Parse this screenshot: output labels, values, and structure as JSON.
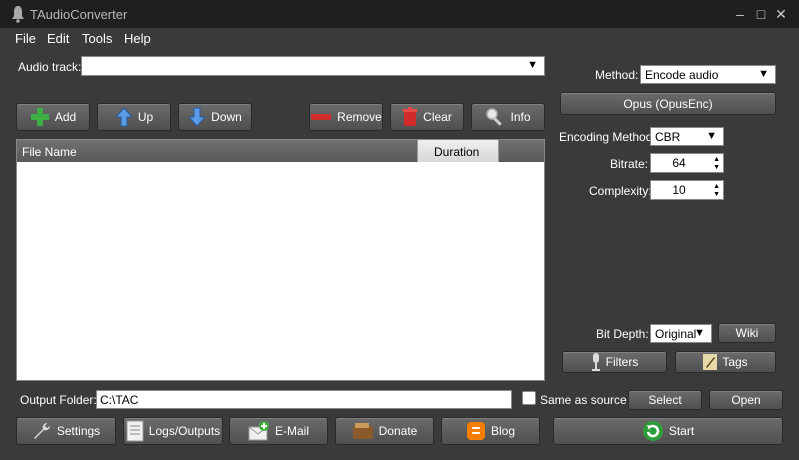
{
  "window": {
    "title": "TAudioConverter",
    "minimize": "–",
    "maximize": "□",
    "close": "✕"
  },
  "menu": [
    "File",
    "Edit",
    "Tools",
    "Help"
  ],
  "audio_track": {
    "label": "Audio track:",
    "value": ""
  },
  "list_buttons": {
    "add": "Add",
    "up": "Up",
    "down": "Down",
    "remove": "Remove",
    "clear": "Clear",
    "info": "Info"
  },
  "file_list": {
    "col_file_name": "File Name",
    "col_duration": "Duration",
    "rows": []
  },
  "encoder": {
    "method_label": "Method:",
    "method_value": "Encode audio",
    "codec_button": "Opus (OpusEnc)",
    "encoding_method_label": "Encoding Method:",
    "encoding_method_value": "CBR",
    "bitrate_label": "Bitrate:",
    "bitrate_value": "64",
    "complexity_label": "Complexity:",
    "complexity_value": "10",
    "bit_depth_label": "Bit Depth:",
    "bit_depth_value": "Original",
    "wiki_button": "Wiki",
    "filters_button": "Filters",
    "tags_button": "Tags"
  },
  "output": {
    "folder_label": "Output Folder:",
    "folder_value": "C:\\TAC",
    "same_as_source_label": "Same as source",
    "same_as_source_checked": false,
    "select_button": "Select",
    "open_button": "Open"
  },
  "bottom_buttons": {
    "settings": "Settings",
    "logs": "Logs/Outputs",
    "email": "E-Mail",
    "donate": "Donate",
    "blog": "Blog",
    "start": "Start"
  },
  "colors": {
    "background": "#3a3a3a",
    "titlebar": "#1f1f1f",
    "button": "#5e5e5e",
    "add_icon": "#3cb043",
    "arrow_icon": "#3a7bd5",
    "remove_icon": "#d22b2b"
  },
  "icons": {
    "app": "bell-icon",
    "add": "plus-icon",
    "up": "arrow-up-icon",
    "down": "arrow-down-icon",
    "remove": "minus-icon",
    "clear": "trash-icon",
    "info": "magnifier-icon",
    "filters": "microphone-icon",
    "tags": "pencil-icon",
    "settings": "wrench-icon",
    "logs": "document-icon",
    "email": "mail-plus-icon",
    "donate": "wallet-icon",
    "blog": "blogger-icon",
    "start": "refresh-icon"
  }
}
